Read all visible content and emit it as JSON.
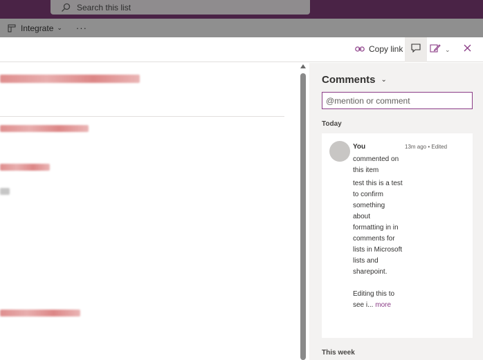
{
  "suitebar": {
    "search_placeholder": "Search this list"
  },
  "cmdbar": {
    "integrate_label": "Integrate",
    "more_label": "···"
  },
  "panel": {
    "copy_link_label": "Copy link"
  },
  "comments": {
    "header": "Comments",
    "input_placeholder": "@mention or comment",
    "group_today": "Today",
    "group_week": "This week",
    "items": [
      {
        "author": "You",
        "meta": "13m ago • Edited",
        "action": "commented on this item",
        "body": "test this is a test to confirm something about formatting in in comments for lists in Microsoft lists and sharepoint.\n\nEditing this to see i...",
        "more_label": "more"
      }
    ]
  },
  "colors": {
    "accent": "#8a3b86",
    "suitebar": "#4a2346"
  }
}
